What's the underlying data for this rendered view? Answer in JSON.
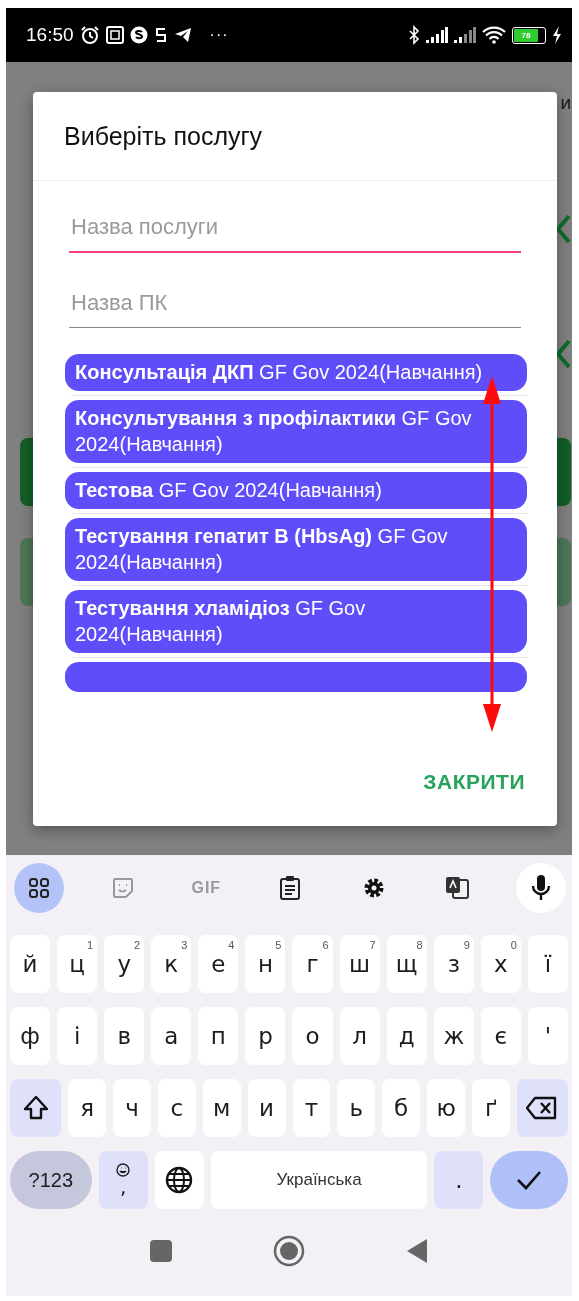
{
  "status_bar": {
    "time": "16:50",
    "more": "···",
    "battery": "78"
  },
  "background": {
    "title_fragment": "и"
  },
  "dialog": {
    "title": "Виберіть послугу",
    "fields": [
      {
        "placeholder": "Назва послуги",
        "focused": true
      },
      {
        "placeholder": "Назва ПК",
        "focused": false
      }
    ],
    "services": [
      {
        "label": "**Консультація ДКП** GF Gov 2024(Навчання)"
      },
      {
        "label": "**Консультування з профілактики** GF Gov 2024(Навчання)"
      },
      {
        "label": "**Тестова** GF Gov 2024(Навчання)"
      },
      {
        "label": "**Тестування гепатит В (HbsAg)** GF Gov 2024(Навчання)"
      },
      {
        "label": "**Тестування хламідіоз** GF Gov 2024(Навчання)"
      }
    ],
    "more_below": true,
    "close_button": "ЗАКРИТИ"
  },
  "keyboard": {
    "toolbar": [
      {
        "kind": "apps",
        "selected": true
      },
      {
        "kind": "sticker",
        "selected": false
      },
      {
        "kind": "gif",
        "label": "GIF",
        "selected": false
      },
      {
        "kind": "clipboard",
        "selected": false
      },
      {
        "kind": "settings",
        "selected": false
      },
      {
        "kind": "translate",
        "selected": false
      },
      {
        "kind": "mic",
        "selected": false
      }
    ],
    "key_rows": [
      {
        "keys": [
          {
            "kind": "letter",
            "label": "й"
          },
          {
            "kind": "letter",
            "label": "ц",
            "hint": "1"
          },
          {
            "kind": "letter",
            "label": "у",
            "hint": "2"
          },
          {
            "kind": "letter",
            "label": "к",
            "hint": "3"
          },
          {
            "kind": "letter",
            "label": "е",
            "hint": "4"
          },
          {
            "kind": "letter",
            "label": "н",
            "hint": "5"
          },
          {
            "kind": "letter",
            "label": "г",
            "hint": "6"
          },
          {
            "kind": "letter",
            "label": "ш",
            "hint": "7"
          },
          {
            "kind": "letter",
            "label": "щ",
            "hint": "8"
          },
          {
            "kind": "letter",
            "label": "з",
            "hint": "9"
          },
          {
            "kind": "letter",
            "label": "х",
            "hint": "0"
          },
          {
            "kind": "letter",
            "label": "ї"
          }
        ]
      },
      {
        "keys": [
          {
            "kind": "letter",
            "label": "ф"
          },
          {
            "kind": "letter",
            "label": "і"
          },
          {
            "kind": "letter",
            "label": "в"
          },
          {
            "kind": "letter",
            "label": "а"
          },
          {
            "kind": "letter",
            "label": "п"
          },
          {
            "kind": "letter",
            "label": "р"
          },
          {
            "kind": "letter",
            "label": "о"
          },
          {
            "kind": "letter",
            "label": "л"
          },
          {
            "kind": "letter",
            "label": "д"
          },
          {
            "kind": "letter",
            "label": "ж"
          },
          {
            "kind": "letter",
            "label": "є"
          },
          {
            "kind": "letter",
            "label": "'"
          }
        ]
      },
      {
        "keys": [
          {
            "kind": "shift"
          },
          {
            "kind": "letter",
            "label": "я"
          },
          {
            "kind": "letter",
            "label": "ч"
          },
          {
            "kind": "letter",
            "label": "с"
          },
          {
            "kind": "letter",
            "label": "м"
          },
          {
            "kind": "letter",
            "label": "и"
          },
          {
            "kind": "letter",
            "label": "т"
          },
          {
            "kind": "letter",
            "label": "ь"
          },
          {
            "kind": "letter",
            "label": "б"
          },
          {
            "kind": "letter",
            "label": "ю"
          },
          {
            "kind": "letter",
            "label": "ґ"
          },
          {
            "kind": "backspace"
          }
        ]
      },
      {
        "keys": [
          {
            "kind": "symbols",
            "label": "?123"
          },
          {
            "kind": "emoji",
            "label": ","
          },
          {
            "kind": "globe"
          },
          {
            "kind": "space",
            "label": "Українська"
          },
          {
            "kind": "punct",
            "label": "."
          },
          {
            "kind": "enter"
          }
        ]
      }
    ]
  }
}
